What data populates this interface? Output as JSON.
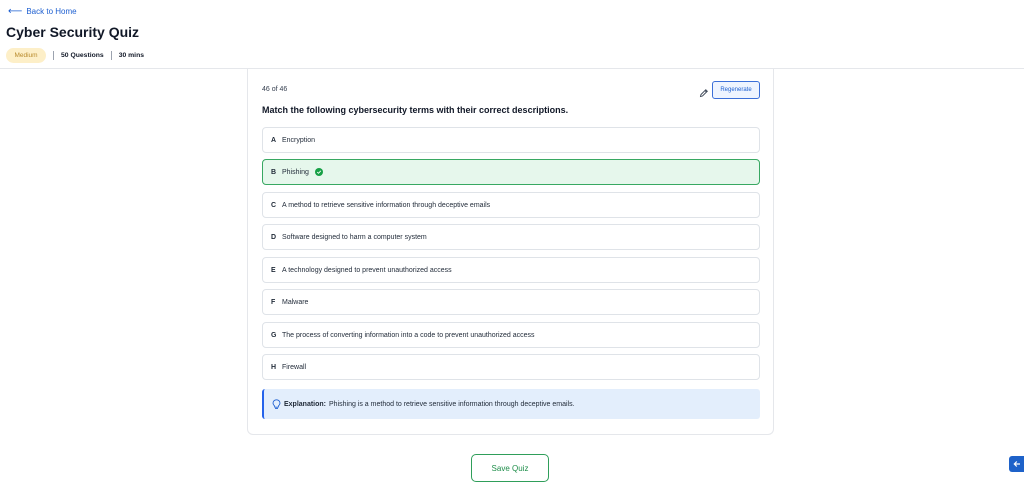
{
  "header": {
    "back_label": "Back to Home",
    "title": "Cyber Security Quiz",
    "difficulty": "Medium",
    "questions": "50 Questions",
    "duration": "30 mins"
  },
  "question_card": {
    "counter": "46 of 46",
    "regenerate_label": "Regenerate",
    "question_text": "Match the following cybersecurity terms with their correct descriptions.",
    "options": [
      {
        "letter": "A",
        "text": "Encryption",
        "correct": false
      },
      {
        "letter": "B",
        "text": "Phishing",
        "correct": true
      },
      {
        "letter": "C",
        "text": "A method to retrieve sensitive information through deceptive emails",
        "correct": false
      },
      {
        "letter": "D",
        "text": "Software designed to harm a computer system",
        "correct": false
      },
      {
        "letter": "E",
        "text": "A technology designed to prevent unauthorized access",
        "correct": false
      },
      {
        "letter": "F",
        "text": "Malware",
        "correct": false
      },
      {
        "letter": "G",
        "text": "The process of converting information into a code to prevent unauthorized access",
        "correct": false
      },
      {
        "letter": "H",
        "text": "Firewall",
        "correct": false
      }
    ],
    "explanation_label": "Explanation:",
    "explanation_text": "Phishing is a method to retrieve sensitive information through deceptive emails."
  },
  "footer": {
    "save_label": "Save Quiz"
  },
  "colors": {
    "accent_blue": "#1d5fd1",
    "correct_green": "#17a046",
    "badge_bg": "#fdefc8"
  }
}
